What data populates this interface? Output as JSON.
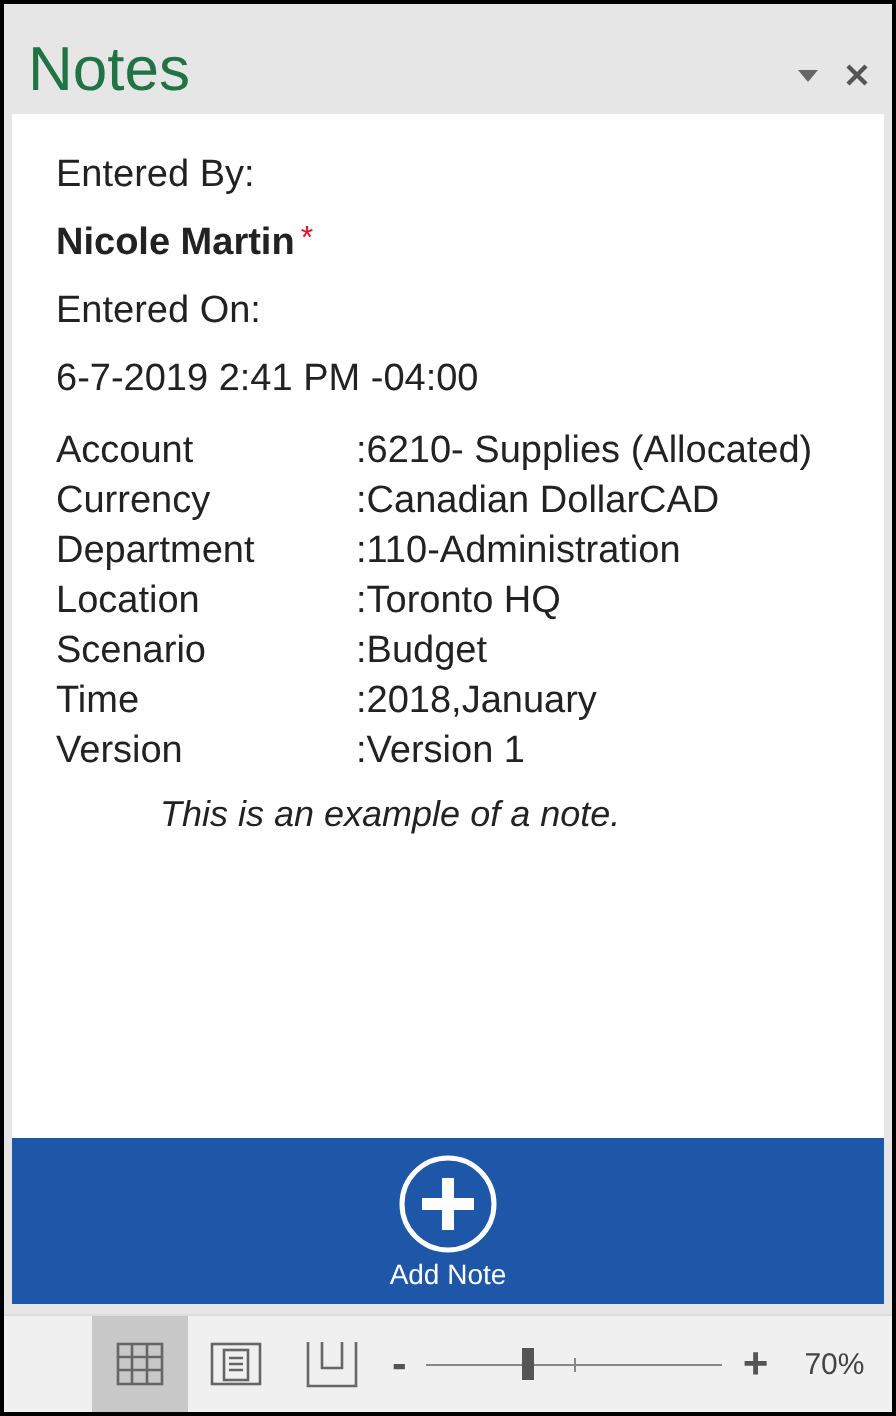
{
  "window": {
    "title": "Notes"
  },
  "note": {
    "entered_by_label": "Entered By:",
    "author": "Nicole Martin",
    "author_mark": "*",
    "entered_on_label": "Entered On:",
    "entered_on": "6-7-2019 2:41 PM -04:00",
    "fields": [
      {
        "label": "Account",
        "value": ":6210- Supplies (Allocated)"
      },
      {
        "label": "Currency",
        "value": ":Canadian DollarCAD"
      },
      {
        "label": "Department",
        "value": ":110-Administration"
      },
      {
        "label": "Location",
        "value": ":Toronto HQ"
      },
      {
        "label": "Scenario",
        "value": ":Budget"
      },
      {
        "label": "Time",
        "value": ":2018,January"
      },
      {
        "label": "Version",
        "value": ":Version 1"
      }
    ],
    "text": "This is an example of a note."
  },
  "add_button": {
    "label": "Add Note"
  },
  "status_bar": {
    "views": [
      {
        "kind": "grid",
        "selected": true
      },
      {
        "kind": "page",
        "selected": false
      },
      {
        "kind": "break",
        "selected": false
      }
    ],
    "zoom_out": "-",
    "zoom_in": "+",
    "zoom": {
      "level": 0.34
    },
    "zoom_reading": "70%"
  }
}
